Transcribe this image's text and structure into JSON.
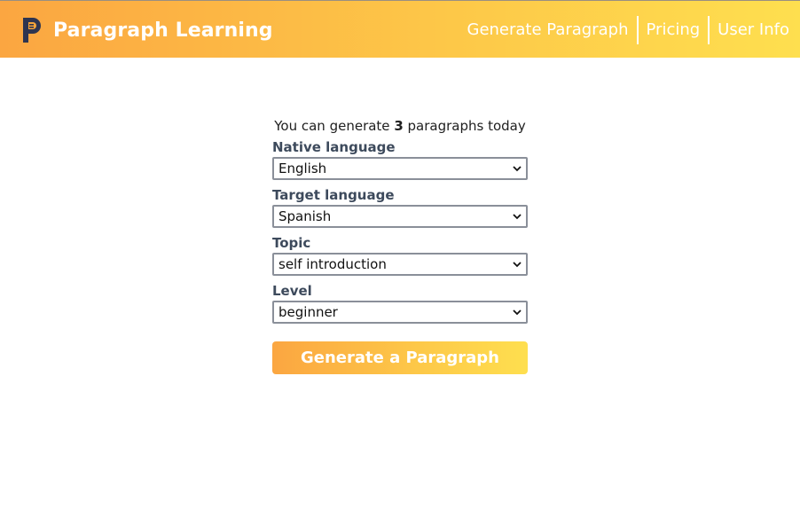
{
  "header": {
    "brand_name": "Paragraph Learning",
    "logo_icon": "paragraph-logo-icon",
    "nav": [
      {
        "label": "Generate Paragraph"
      },
      {
        "label": "Pricing"
      },
      {
        "label": "User Info"
      }
    ]
  },
  "form": {
    "quota_prefix": "You can generate ",
    "quota_count": "3",
    "quota_suffix": " paragraphs today",
    "fields": [
      {
        "label": "Native language",
        "value": "English"
      },
      {
        "label": "Target language",
        "value": "Spanish"
      },
      {
        "label": "Topic",
        "value": "self introduction"
      },
      {
        "label": "Level",
        "value": "beginner"
      }
    ],
    "submit_label": "Generate a Paragraph"
  },
  "colors": {
    "header_gradient_start": "#fba641",
    "header_gradient_end": "#fedf4f",
    "logo_dark": "#2e3550",
    "logo_accent": "#f5a43a",
    "label_color": "#3d4a5c"
  }
}
